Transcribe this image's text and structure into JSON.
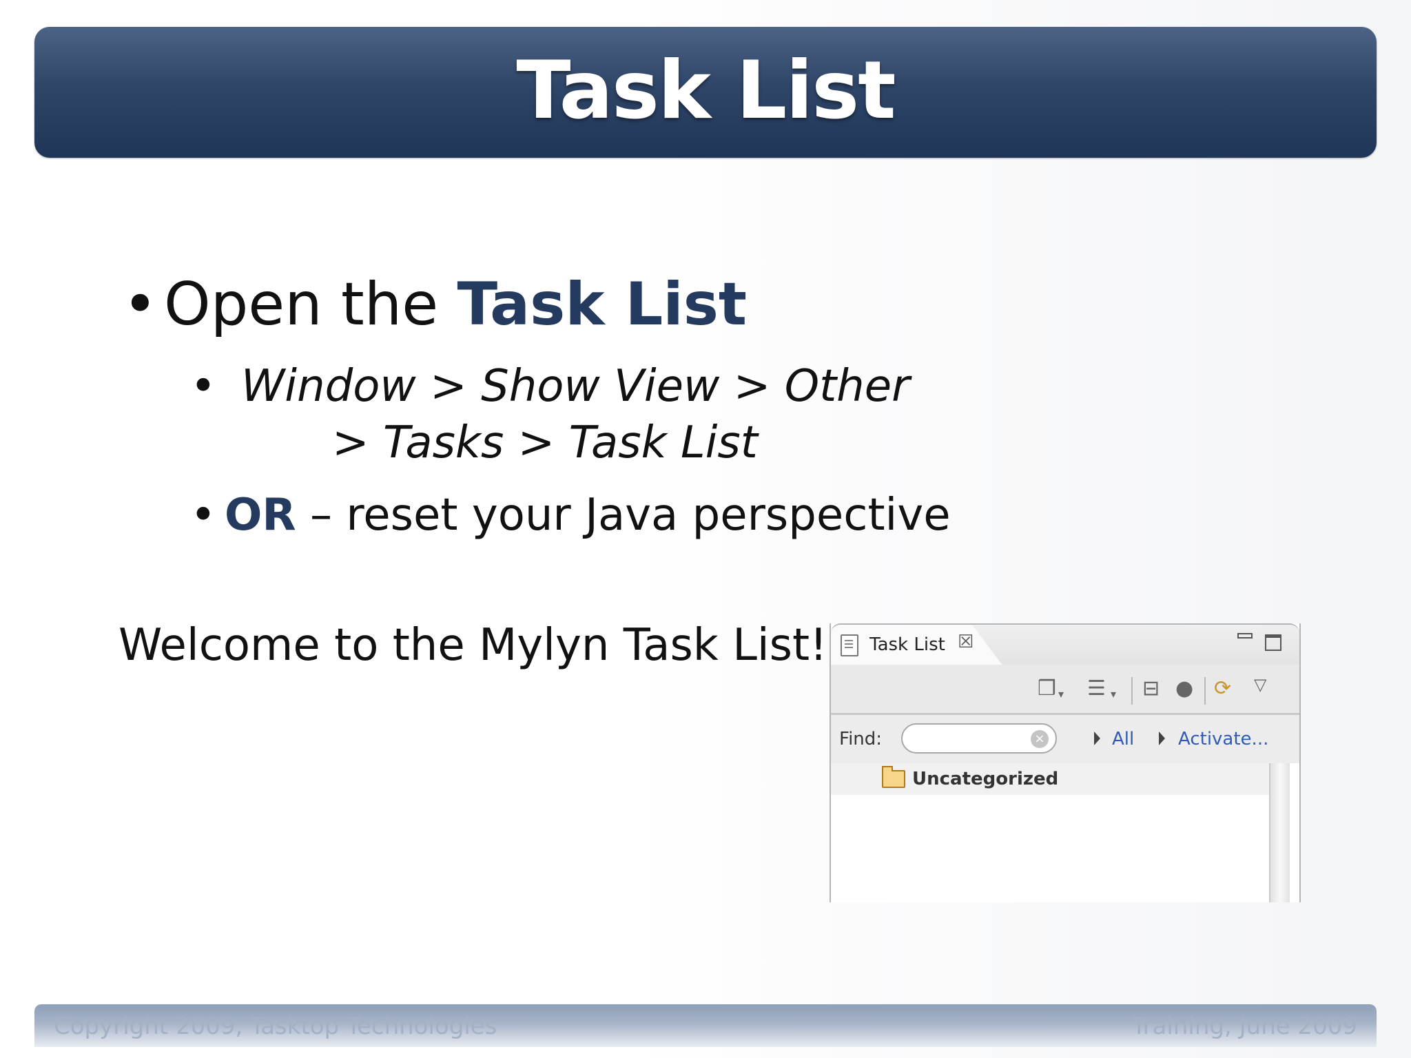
{
  "slide": {
    "title": "Task List",
    "bullet1": {
      "prefix": "Open the ",
      "emphasis": "Task List"
    },
    "bullet2": {
      "line1": "Window > Show View > Other",
      "line2": "> Tasks > Task List"
    },
    "bullet3": {
      "emphasis": "OR",
      "rest": " – reset your Java perspective"
    },
    "welcome": "Welcome to the Mylyn Task List!",
    "bullet_glyph": "•"
  },
  "panel": {
    "tab_label": "Task List",
    "tab_close": "☒",
    "find_label": "Find:",
    "find_value": "",
    "find_placeholder": "",
    "filter_all": "All",
    "activate": "Activate...",
    "category": "Uncategorized",
    "toolbar_icons": [
      "new-task-icon",
      "presentation-icon",
      "collapse-all-icon",
      "focus-icon",
      "synchronize-icon",
      "view-menu-icon"
    ]
  },
  "footer": {
    "left": "Copyright 2009, Tasktop Technologies",
    "right": "Training, June 2009"
  },
  "colors": {
    "title_bar": "#2f4668",
    "accent_text": "#243a5e",
    "link": "#2f5bb6"
  }
}
